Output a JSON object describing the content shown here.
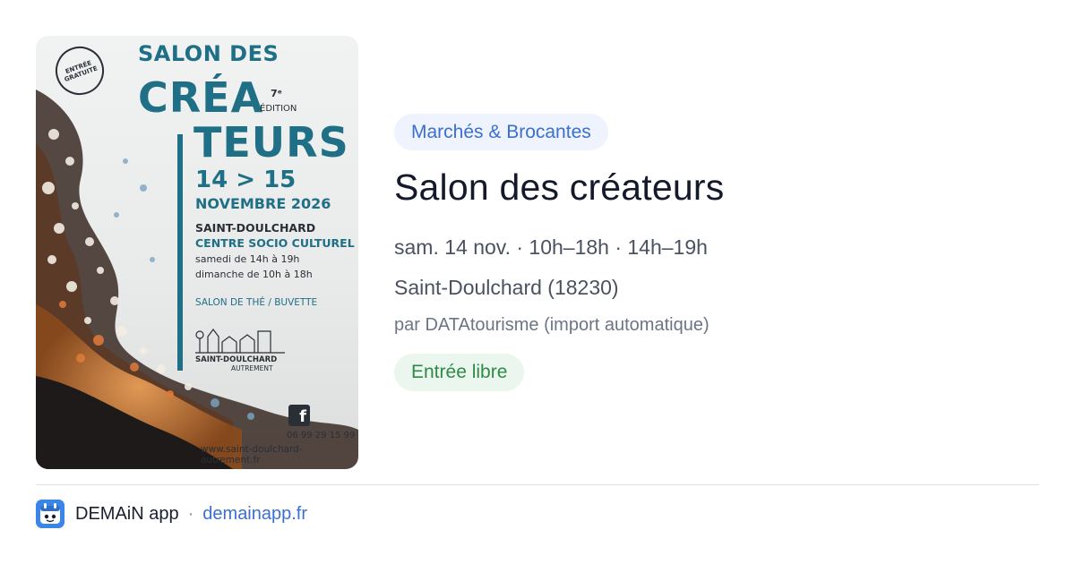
{
  "poster": {
    "badge_line1": "ENTRÉE",
    "badge_line2": "GRATUITE",
    "salon": "SALON DES",
    "crea": "CRÉA",
    "teurs": "TEURS",
    "edition_num": "7ᵉ",
    "edition_label": "ÉDITION",
    "dates": "14 > 15",
    "month": "NOVEMBRE 2026",
    "city": "SAINT-DOULCHARD",
    "venue": "CENTRE SOCIO CULTUREL",
    "saturday": "samedi de 14h à 19h",
    "sunday": "dimanche de 10h à 18h",
    "tea": "SALON DE THÉ / BUVETTE",
    "org_line1": "SAINT-DOULCHARD",
    "org_line2": "AUTREMENT",
    "facebook": "f",
    "phone": "06 99 29 15 99",
    "website": "www.saint-doulchard-autrement.fr"
  },
  "event": {
    "category": "Marchés & Brocantes",
    "title": "Salon des créateurs",
    "schedule": "sam. 14 nov. · 10h–18h · 14h–19h",
    "location": "Saint-Doulchard (18230)",
    "source": "par DATAtourisme (import automatique)",
    "price": "Entrée libre"
  },
  "footer": {
    "app_name": "DEMAiN app",
    "separator": "·",
    "link": "demainapp.fr"
  },
  "colors": {
    "accent_blue": "#3b6fd0",
    "category_bg": "#eef3fd",
    "price_green": "#2f8a47",
    "price_bg": "#ebf7ee",
    "poster_teal": "#1f6f86"
  }
}
